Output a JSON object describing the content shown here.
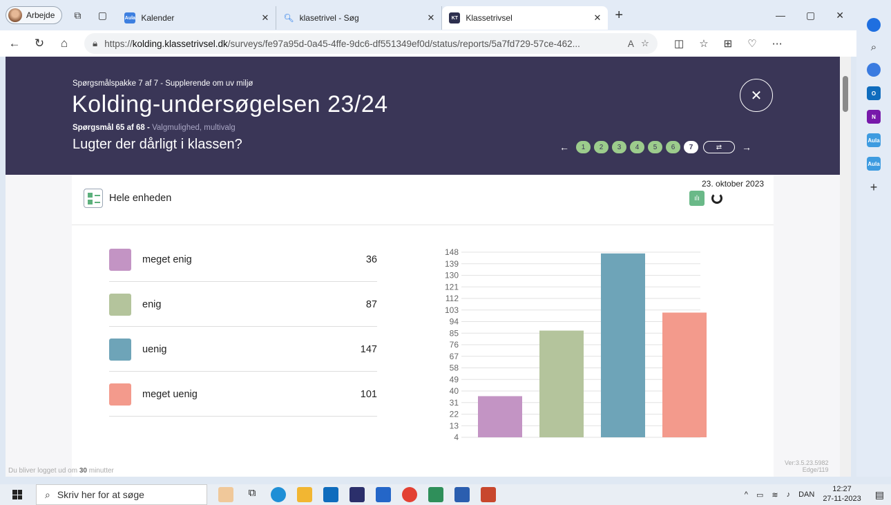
{
  "browser": {
    "profile_label": "Arbejde",
    "tabs": [
      {
        "label": "Kalender",
        "favicon": "Aula",
        "color": "#3d7fe0"
      },
      {
        "label": "klasetrivel - Søg",
        "favicon": "search-icon"
      },
      {
        "label": "Klassetrivsel",
        "favicon": "KT",
        "color": "#2d2f4e"
      }
    ],
    "url_prefix": "https://",
    "url_host": "kolding.klassetrivsel.dk",
    "url_path": "/surveys/fe97a95d-0a45-4ffe-9dc6-df551349ef0d/status/reports/5a7fd729-57ce-462..."
  },
  "header": {
    "package": "Spørgsmålspakke 7 af 7 - Supplerende om uv miljø",
    "title": "Kolding-undersøgelsen 23/24",
    "question_number": "Spørgsmål 65 af 68 -",
    "question_type": "Valgmulighed, multivalg",
    "question": "Lugter der dårligt i klassen?",
    "steps": [
      "1",
      "2",
      "3",
      "4",
      "5",
      "6",
      "7"
    ],
    "current_step": "7"
  },
  "card": {
    "unit_label": "Hele enheden",
    "date": "23. oktober 2023"
  },
  "legend": [
    {
      "label": "meget enig",
      "value": "36",
      "color": "#c394c4"
    },
    {
      "label": "enig",
      "value": "87",
      "color": "#b4c49c"
    },
    {
      "label": "uenig",
      "value": "147",
      "color": "#6ea4b8"
    },
    {
      "label": "meget uenig",
      "value": "101",
      "color": "#f39a8c"
    }
  ],
  "chart_data": {
    "type": "bar",
    "categories": [
      "meget enig",
      "enig",
      "uenig",
      "meget uenig"
    ],
    "values": [
      36,
      87,
      147,
      101
    ],
    "colors": [
      "#c394c4",
      "#b4c49c",
      "#6ea4b8",
      "#f39a8c"
    ],
    "y_ticks": [
      "148",
      "139",
      "130",
      "121",
      "112",
      "103",
      "94",
      "85",
      "76",
      "67",
      "58",
      "49",
      "40",
      "31",
      "22",
      "13",
      "4"
    ],
    "ylim": [
      4,
      148
    ],
    "grid": true
  },
  "status": {
    "logout_prefix": "Du bliver logget ud om",
    "logout_minutes": "30",
    "logout_suffix": "minutter",
    "version": "Ver:3.5.23.5982",
    "edge": "Edge/119"
  },
  "taskbar": {
    "search_placeholder": "Skriv her for at søge",
    "language": "DAN",
    "time": "12:27",
    "date": "27-11-2023"
  }
}
